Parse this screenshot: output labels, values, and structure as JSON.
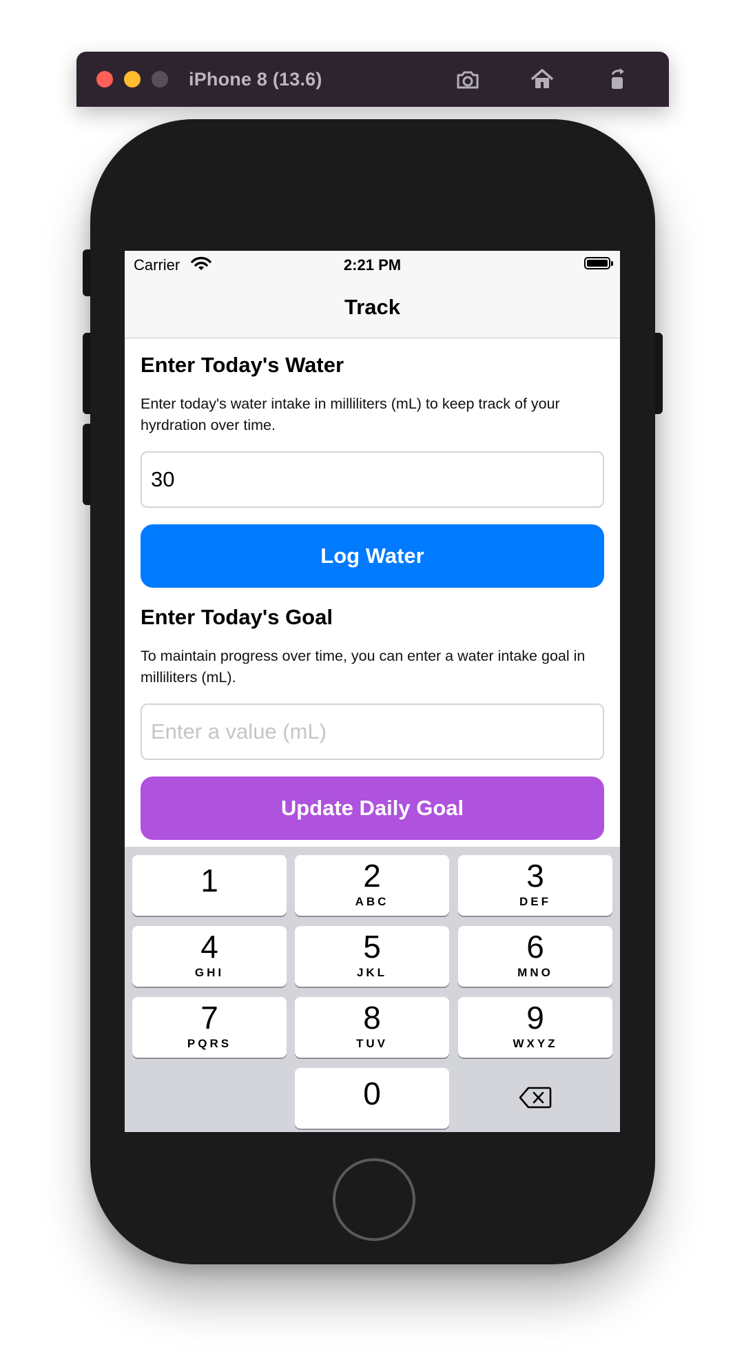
{
  "window": {
    "title": "iPhone 8 (13.6)",
    "toolbar_icons": [
      "screenshot-icon",
      "home-icon",
      "rotate-icon"
    ]
  },
  "status_bar": {
    "carrier": "Carrier",
    "time": "2:21 PM"
  },
  "nav": {
    "title": "Track"
  },
  "water": {
    "heading": "Enter Today's Water",
    "description": "Enter today's water intake in milliliters (mL) to keep track of your hyrdration over time.",
    "value": "30",
    "button_label": "Log Water",
    "button_color": "#007aff"
  },
  "goal": {
    "heading": "Enter Today's Goal",
    "description": "To maintain progress over time, you can enter a water intake goal in milliliters (mL).",
    "placeholder": "Enter a value (mL)",
    "value": "",
    "button_label": "Update Daily Goal",
    "button_color": "#af52de"
  },
  "keypad": {
    "keys": [
      {
        "num": "1",
        "letters": ""
      },
      {
        "num": "2",
        "letters": "ABC"
      },
      {
        "num": "3",
        "letters": "DEF"
      },
      {
        "num": "4",
        "letters": "GHI"
      },
      {
        "num": "5",
        "letters": "JKL"
      },
      {
        "num": "6",
        "letters": "MNO"
      },
      {
        "num": "7",
        "letters": "PQRS"
      },
      {
        "num": "8",
        "letters": "TUV"
      },
      {
        "num": "9",
        "letters": "WXYZ"
      },
      {
        "num": "0",
        "letters": ""
      }
    ],
    "delete_icon": "backspace-icon"
  }
}
